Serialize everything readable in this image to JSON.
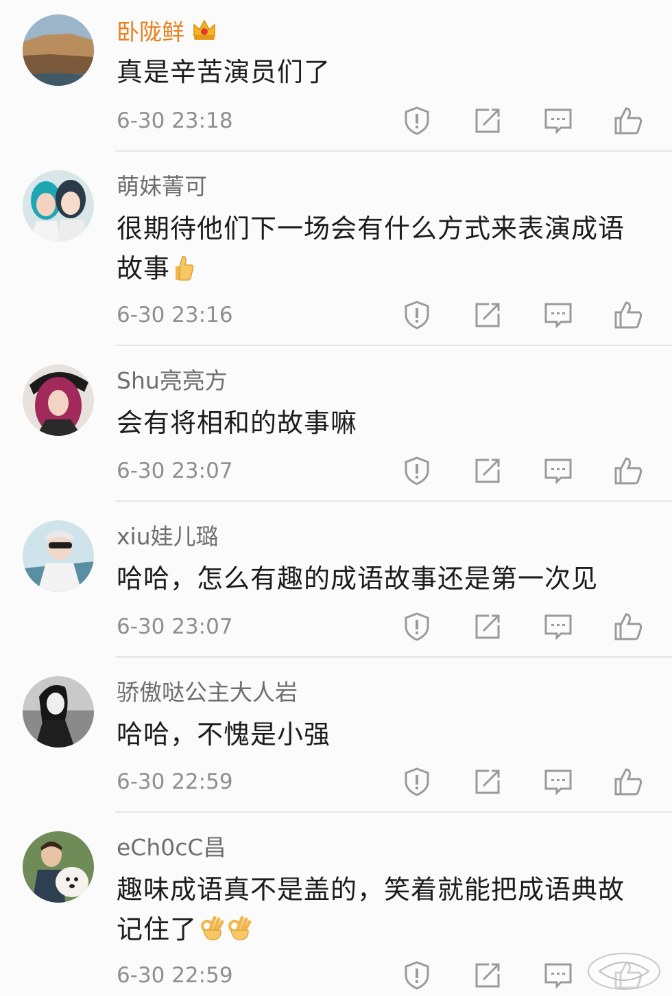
{
  "comments": [
    {
      "username": "卧陇鲜",
      "vip": true,
      "text": "真是辛苦演员们了",
      "emoji": [],
      "time": "6-30 23:18",
      "avatar": "coastal-cliff-avatar"
    },
    {
      "username": "萌妹菁可",
      "vip": false,
      "text": "很期待他们下一场会有什么方式来表演成语\n故事",
      "emoji": [
        "thumbs-up-emoji"
      ],
      "time": "6-30 23:16",
      "avatar": "two-girls-avatar"
    },
    {
      "username": "Shu亮亮方",
      "vip": false,
      "text": "会有将相和的故事嘛",
      "emoji": [],
      "time": "6-30 23:07",
      "avatar": "pink-hair-girl-avatar"
    },
    {
      "username": "xiu娃儿璐",
      "vip": false,
      "text": "哈哈，怎么有趣的成语故事还是第一次见",
      "emoji": [],
      "time": "6-30 23:07",
      "avatar": "sunglasses-avatar"
    },
    {
      "username": "骄傲哒公主大人岩",
      "vip": false,
      "text": "哈哈，不愧是小强",
      "emoji": [],
      "time": "6-30 22:59",
      "avatar": "bw-portrait-avatar"
    },
    {
      "username": "eCh0cC昌",
      "vip": false,
      "text": "趣味成语真不是盖的，笑着就能把成语典故\n记住了",
      "emoji": [
        "ok-hand-emoji",
        "ok-hand-emoji"
      ],
      "time": "6-30 22:59",
      "avatar": "man-with-dog-avatar"
    }
  ],
  "actions": {
    "report_icon": "report-icon",
    "repost_icon": "repost-icon",
    "reply_icon": "reply-icon",
    "like_icon": "like-icon"
  },
  "colors": {
    "vip_username": "#e8811d",
    "username": "#6e6e6e",
    "text": "#1c1c1c",
    "time": "#8f8f8f",
    "icon": "#9a9a9a",
    "divider": "#e6e6e6"
  }
}
